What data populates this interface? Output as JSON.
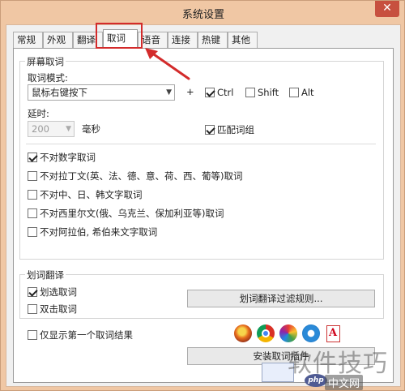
{
  "window": {
    "title": "系统设置",
    "close_glyph": "✕"
  },
  "tabs": [
    {
      "label": "常规",
      "active": false
    },
    {
      "label": "外观",
      "active": false
    },
    {
      "label": "翻译",
      "active": false
    },
    {
      "label": "取词",
      "active": true
    },
    {
      "label": "语音",
      "active": false
    },
    {
      "label": "连接",
      "active": false
    },
    {
      "label": "热键",
      "active": false
    },
    {
      "label": "其他",
      "active": false
    }
  ],
  "screen_capture": {
    "group_title": "屏幕取词",
    "mode_label": "取词模式:",
    "mode_value": "鼠标右键按下",
    "plus": "+",
    "modifiers": [
      {
        "label": "Ctrl",
        "checked": true
      },
      {
        "label": "Shift",
        "checked": false
      },
      {
        "label": "Alt",
        "checked": false
      }
    ],
    "delay_label": "延时:",
    "delay_value": "200",
    "delay_unit": "毫秒",
    "match_phrase": {
      "label": "匹配词组",
      "checked": true
    },
    "options": [
      {
        "label": "不对数字取词",
        "checked": true
      },
      {
        "label": "不对拉丁文(英、法、德、意、荷、西、葡等)取词",
        "checked": false
      },
      {
        "label": "不对中、日、韩文字取词",
        "checked": false
      },
      {
        "label": "不对西里尔文(俄、乌克兰、保加利亚等)取词",
        "checked": false
      },
      {
        "label": "不对阿拉伯, 希伯来文字取词",
        "checked": false
      }
    ]
  },
  "selection_translate": {
    "group_title": "划词翻译",
    "options": [
      {
        "label": "划选取词",
        "checked": true
      },
      {
        "label": "双击取词",
        "checked": false
      }
    ],
    "filter_button": "划词翻译过滤规则..."
  },
  "first_result_only": {
    "label": "仅显示第一个取词结果",
    "checked": false
  },
  "browser_icons": [
    "firefox-icon",
    "chrome-icon",
    "color-wheel-icon",
    "ie-icon",
    "pdf-icon"
  ],
  "install_button": "安装取词插件",
  "watermark": {
    "main": "软件技巧",
    "site": "中文网",
    "logo": "php"
  },
  "colors": {
    "highlight": "#d32b2b",
    "window_frame": "#f0c7a4"
  }
}
